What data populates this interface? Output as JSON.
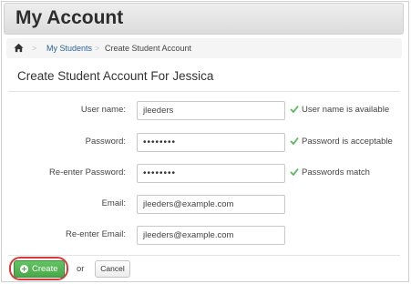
{
  "header": {
    "title": "My Account"
  },
  "breadcrumb": {
    "home_icon": "home-icon",
    "separator": ">",
    "items": [
      {
        "label": "My Students",
        "link": true
      },
      {
        "label": "Create Student Account",
        "link": false
      }
    ]
  },
  "form": {
    "title": "Create Student Account For Jessica",
    "fields": [
      {
        "label": "User name:",
        "value": "jleeders",
        "status": "User name is available"
      },
      {
        "label": "Password:",
        "value": "••••••••",
        "status": "Password is acceptable"
      },
      {
        "label": "Re-enter Password:",
        "value": "••••••••",
        "status": "Passwords match"
      },
      {
        "label": "Email:",
        "value": "jleeders@example.com",
        "status": ""
      },
      {
        "label": "Re-enter Email:",
        "value": "jleeders@example.com",
        "status": ""
      }
    ]
  },
  "actions": {
    "create_label": "Create",
    "or_label": "or",
    "cancel_label": "Cancel"
  },
  "colors": {
    "success_check": "#5cb85c",
    "create_button": "#4aa84a",
    "highlight_ring": "#d9383a",
    "link": "#2a6496"
  }
}
